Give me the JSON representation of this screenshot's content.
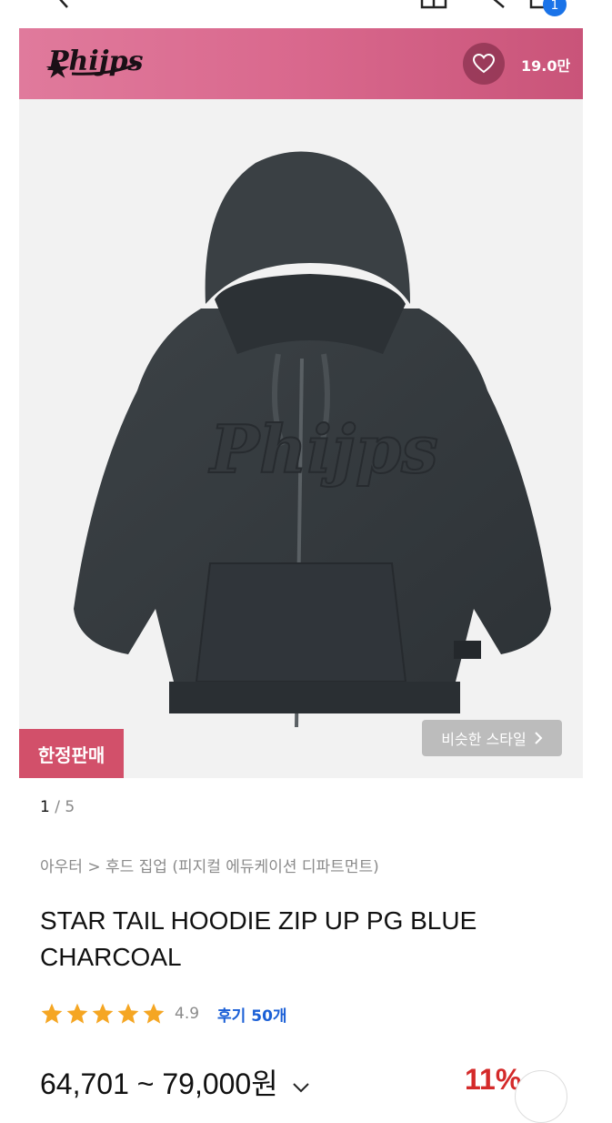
{
  "header": {
    "cart_count": "1"
  },
  "brand": {
    "logo_text": "Phijps",
    "likes": "19.0만"
  },
  "image": {
    "limited_label": "한정판매",
    "similar_label": "비슷한 스타일",
    "page_current": "1",
    "page_sep": " / ",
    "page_total": "5"
  },
  "product": {
    "breadcrumb": "아우터 > 후드 집업 (피지컬 에듀케이션 디파트먼트)",
    "title": "STAR TAIL HOODIE ZIP UP PG BLUE CHARCOAL",
    "rating": "4.9",
    "reviews": "후기 50개",
    "price": "64,701 ~ 79,000원",
    "discount": "11%"
  },
  "colors": {
    "star": "#f5a623",
    "accent": "#d2506a",
    "link": "#1a5fd6"
  }
}
